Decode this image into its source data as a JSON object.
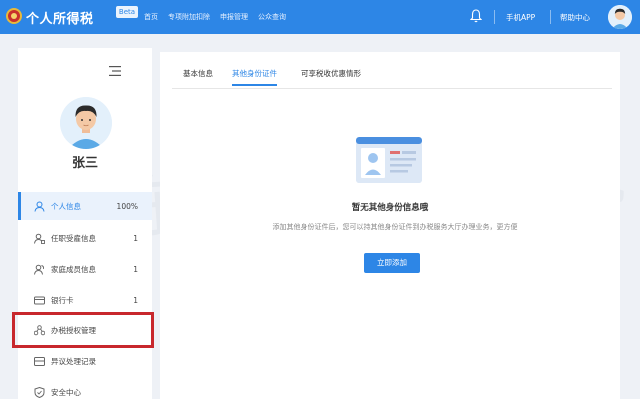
{
  "header": {
    "app_title": "个人所得税",
    "badge": "Beta",
    "nav": [
      "首页",
      "专项附加扣除",
      "申报管理",
      "公众查询"
    ],
    "mobile_app": "手机APP",
    "help_center": "帮助中心"
  },
  "sidebar": {
    "user_name": "张三",
    "items": [
      {
        "label": "个人信息",
        "count": "100%",
        "icon": "person-icon"
      },
      {
        "label": "任职受雇信息",
        "count": "1",
        "icon": "employment-icon"
      },
      {
        "label": "家庭成员信息",
        "count": "1",
        "icon": "family-icon"
      },
      {
        "label": "银行卡",
        "count": "1",
        "icon": "card-icon"
      },
      {
        "label": "办税授权管理",
        "count": "",
        "icon": "authorization-icon"
      },
      {
        "label": "异议处理记录",
        "count": "",
        "icon": "record-icon"
      },
      {
        "label": "安全中心",
        "count": "",
        "icon": "shield-icon"
      }
    ]
  },
  "main": {
    "tabs": [
      "基本信息",
      "其他身份证件",
      "可享税收优惠情形"
    ],
    "active_tab": 1,
    "empty_title": "暂无其他身份信息哦",
    "empty_desc": "添加其他身份证件后，您可以持其他身份证件到办税服务大厅办理业务，更方便",
    "add_button": "立即添加"
  },
  "watermark": "东 评 心 税",
  "colors": {
    "brand": "#2d86e6",
    "highlight": "#c8282d"
  }
}
